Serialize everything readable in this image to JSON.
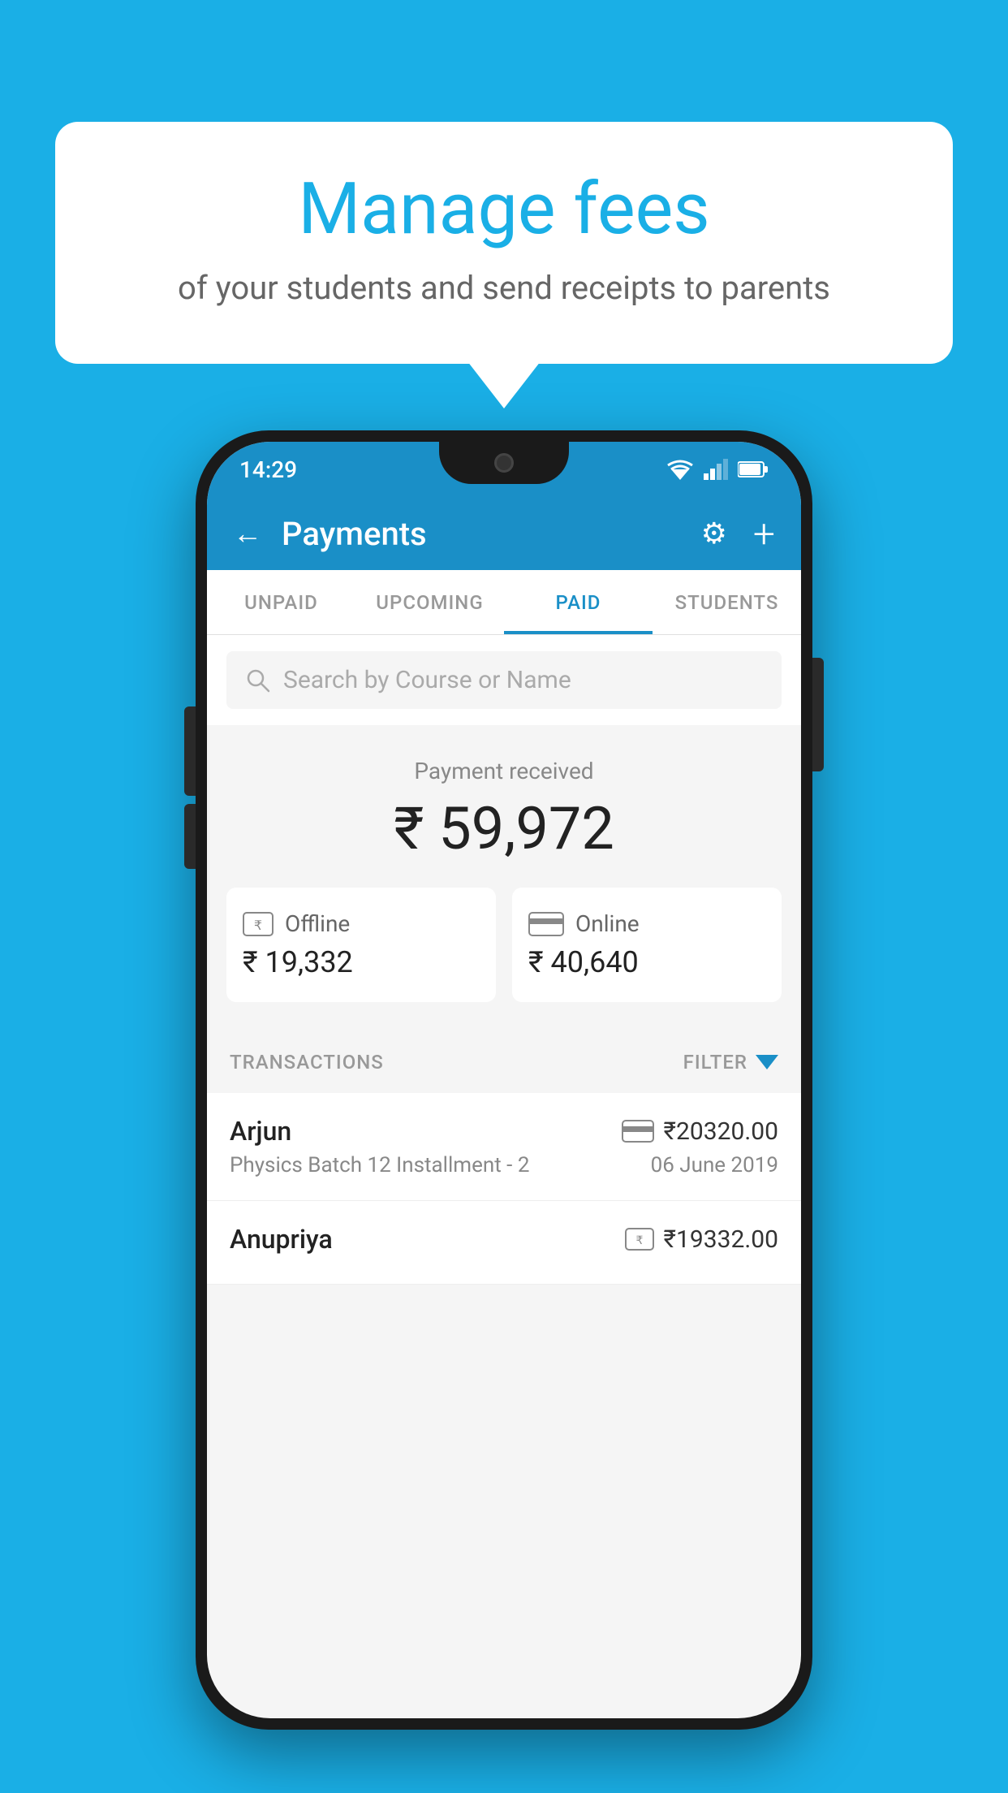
{
  "background_color": "#1AAFE6",
  "speech_bubble": {
    "title": "Manage fees",
    "subtitle": "of your students and send receipts to parents"
  },
  "status_bar": {
    "time": "14:29"
  },
  "header": {
    "title": "Payments",
    "back_label": "←"
  },
  "tabs": [
    {
      "id": "unpaid",
      "label": "UNPAID",
      "active": false
    },
    {
      "id": "upcoming",
      "label": "UPCOMING",
      "active": false
    },
    {
      "id": "paid",
      "label": "PAID",
      "active": true
    },
    {
      "id": "students",
      "label": "STUDENTS",
      "active": false
    }
  ],
  "search": {
    "placeholder": "Search by Course or Name"
  },
  "payment_summary": {
    "label": "Payment received",
    "amount": "₹ 59,972",
    "offline": {
      "type": "Offline",
      "amount": "₹ 19,332"
    },
    "online": {
      "type": "Online",
      "amount": "₹ 40,640"
    }
  },
  "transactions_section": {
    "label": "TRANSACTIONS",
    "filter_label": "FILTER"
  },
  "transactions": [
    {
      "name": "Arjun",
      "course": "Physics Batch 12 Installment - 2",
      "amount": "₹20320.00",
      "date": "06 June 2019",
      "payment_type": "card"
    },
    {
      "name": "Anupriya",
      "course": "",
      "amount": "₹19332.00",
      "date": "",
      "payment_type": "offline"
    }
  ],
  "icons": {
    "gear": "⚙",
    "plus": "+",
    "back": "←",
    "search": "🔍",
    "filter": "▼"
  },
  "colors": {
    "primary": "#1a8fc7",
    "background": "#1AAFE6",
    "white": "#ffffff",
    "text_dark": "#222222",
    "text_light": "#888888"
  }
}
